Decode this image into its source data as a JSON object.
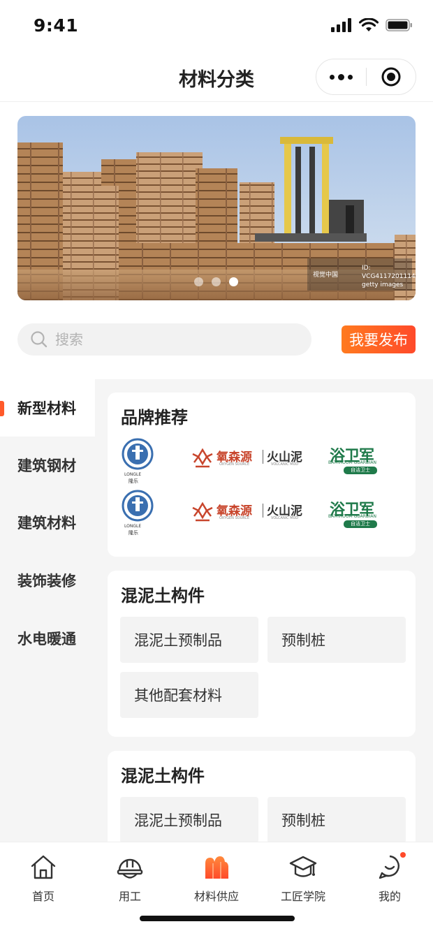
{
  "status_bar": {
    "time": "9:41"
  },
  "nav": {
    "title": "材料分类"
  },
  "banner": {
    "watermark_left": "视觉中国",
    "watermark_id": "ID: VCG41172011149",
    "watermark_brand": "getty images",
    "slide_count": 3,
    "active_slide": 3
  },
  "search": {
    "placeholder": "搜索"
  },
  "publish_button": "我要发布",
  "sidebar": {
    "items": [
      {
        "label": "新型材料",
        "active": true
      },
      {
        "label": "建筑钢材",
        "active": false
      },
      {
        "label": "建筑材料",
        "active": false
      },
      {
        "label": "装饰装修",
        "active": false
      },
      {
        "label": "水电暖通",
        "active": false
      }
    ]
  },
  "brand_card": {
    "title": "品牌推荐",
    "brands": [
      {
        "name": "LONGLE",
        "sub": "隆乐"
      },
      {
        "name": "氧森源",
        "sub1": "火山泥",
        "en1": "OXYGEN SOURCE",
        "en2": "VOLCANIC MUD"
      },
      {
        "name": "浴卫军",
        "en": "BATHROOM GUARDIAN",
        "sub": "自洁卫士"
      }
    ]
  },
  "category_cards": [
    {
      "title": "混泥土构件",
      "chips": [
        "混泥土预制品",
        "预制桩",
        "其他配套材料"
      ]
    },
    {
      "title": "混泥土构件",
      "chips": [
        "混泥土预制品",
        "预制桩"
      ]
    }
  ],
  "tabs": [
    {
      "label": "首页",
      "icon": "home-icon"
    },
    {
      "label": "用工",
      "icon": "hardhat-icon"
    },
    {
      "label": "材料供应",
      "icon": "materials-icon",
      "active": true
    },
    {
      "label": "工匠学院",
      "icon": "graduation-cap-icon"
    },
    {
      "label": "我的",
      "icon": "profile-icon",
      "badge": true
    }
  ],
  "colors": {
    "accent": "#ff5a2a",
    "brand_green": "#1f7a4a",
    "brand_red": "#c8452c"
  }
}
